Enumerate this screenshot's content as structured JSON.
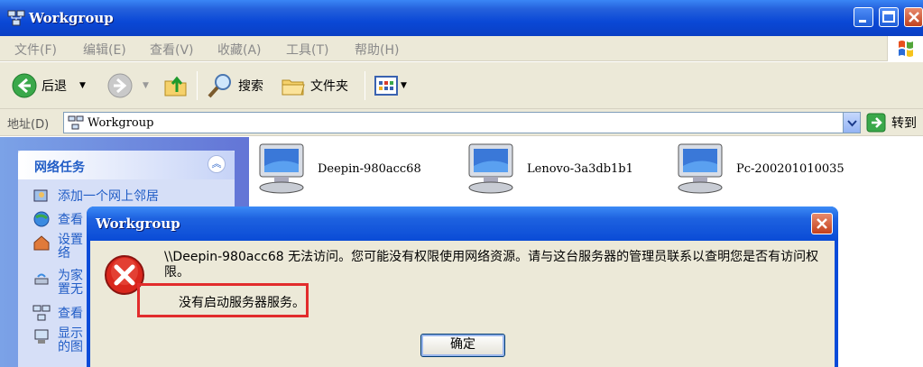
{
  "window": {
    "title": "Workgroup"
  },
  "menu": [
    "文件(F)",
    "编辑(E)",
    "查看(V)",
    "收藏(A)",
    "工具(T)",
    "帮助(H)"
  ],
  "toolbar": {
    "back_label": "后退",
    "search_label": "搜索",
    "folders_label": "文件夹"
  },
  "address": {
    "label": "地址(D)",
    "value": "Workgroup",
    "go_label": "转到"
  },
  "tasks": {
    "header": "网络任务",
    "items": [
      "添加一个网上邻居",
      "查看",
      "设置",
      "络",
      "为家",
      "置无",
      "查看",
      "显示",
      "的图"
    ]
  },
  "computers": [
    "Deepin-980acc68",
    "Lenovo-3a3db1b1",
    "Pc-200201010035"
  ],
  "dialog": {
    "title": "Workgroup",
    "message": "\\\\Deepin-980acc68 无法访问。您可能没有权限使用网络资源。请与这台服务器的管理员联系以查明您是否有访问权限。",
    "detail": "没有启动服务器服务。",
    "ok_label": "确定"
  },
  "colors": {
    "xp_blue": "#0a4bd9",
    "task_link": "#215dc6",
    "highlight_border": "#e22c2c"
  }
}
